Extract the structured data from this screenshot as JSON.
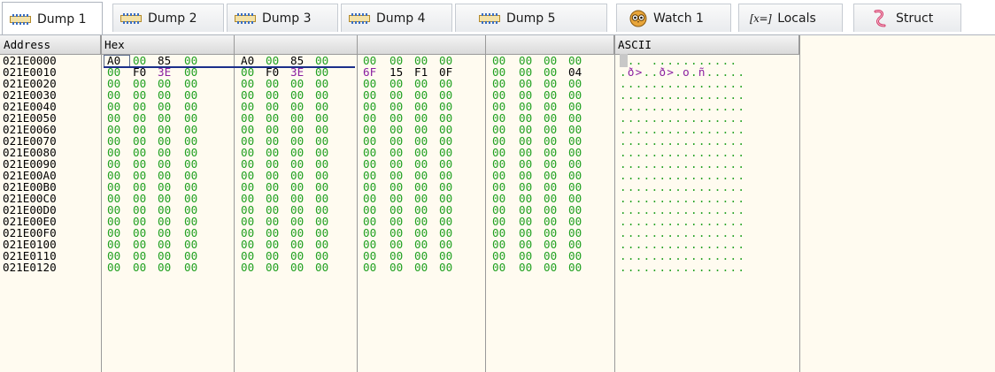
{
  "tabs": [
    {
      "label": "Dump 1",
      "icon": "memory-dump-icon",
      "active": true
    },
    {
      "label": "Dump 2",
      "icon": "memory-dump-icon",
      "active": false
    },
    {
      "label": "Dump 3",
      "icon": "memory-dump-icon",
      "active": false
    },
    {
      "label": "Dump 4",
      "icon": "memory-dump-icon",
      "active": false
    },
    {
      "label": "Dump 5",
      "icon": "memory-dump-icon",
      "active": false
    },
    {
      "label": "Watch 1",
      "icon": "watch-owl-icon",
      "active": false
    },
    {
      "label": "Locals",
      "icon": "locals-x-icon",
      "icon_text": "[x=]",
      "active": false
    },
    {
      "label": "Struct",
      "icon": "struct-icon",
      "active": false
    }
  ],
  "columns": {
    "address": "Address",
    "hex": "Hex",
    "ascii": "ASCII"
  },
  "colors": {
    "zero_byte": "#20a020",
    "nonzero_byte": "#000000",
    "ascii_printable": "#8a1fa0",
    "ascii_dot": "#20a020",
    "background": "#fffbf0",
    "selection_underline": "#1b2f8a"
  },
  "rows": [
    {
      "address": "021E0000",
      "bytes": [
        "A0",
        "00",
        "85",
        "00",
        "A0",
        "00",
        "85",
        "00",
        "00",
        "00",
        "00",
        "00",
        "00",
        "00",
        "00",
        "00"
      ],
      "ascii": "... ..........."
    },
    {
      "address": "021E0010",
      "bytes": [
        "00",
        "F0",
        "3E",
        "00",
        "00",
        "F0",
        "3E",
        "00",
        "6F",
        "15",
        "F1",
        "0F",
        "00",
        "00",
        "00",
        "04"
      ],
      "ascii": ".ð>..ð>.o.ñ....."
    },
    {
      "address": "021E0020",
      "bytes": [
        "00",
        "00",
        "00",
        "00",
        "00",
        "00",
        "00",
        "00",
        "00",
        "00",
        "00",
        "00",
        "00",
        "00",
        "00",
        "00"
      ],
      "ascii": "................"
    },
    {
      "address": "021E0030",
      "bytes": [
        "00",
        "00",
        "00",
        "00",
        "00",
        "00",
        "00",
        "00",
        "00",
        "00",
        "00",
        "00",
        "00",
        "00",
        "00",
        "00"
      ],
      "ascii": "................"
    },
    {
      "address": "021E0040",
      "bytes": [
        "00",
        "00",
        "00",
        "00",
        "00",
        "00",
        "00",
        "00",
        "00",
        "00",
        "00",
        "00",
        "00",
        "00",
        "00",
        "00"
      ],
      "ascii": "................"
    },
    {
      "address": "021E0050",
      "bytes": [
        "00",
        "00",
        "00",
        "00",
        "00",
        "00",
        "00",
        "00",
        "00",
        "00",
        "00",
        "00",
        "00",
        "00",
        "00",
        "00"
      ],
      "ascii": "................"
    },
    {
      "address": "021E0060",
      "bytes": [
        "00",
        "00",
        "00",
        "00",
        "00",
        "00",
        "00",
        "00",
        "00",
        "00",
        "00",
        "00",
        "00",
        "00",
        "00",
        "00"
      ],
      "ascii": "................"
    },
    {
      "address": "021E0070",
      "bytes": [
        "00",
        "00",
        "00",
        "00",
        "00",
        "00",
        "00",
        "00",
        "00",
        "00",
        "00",
        "00",
        "00",
        "00",
        "00",
        "00"
      ],
      "ascii": "................"
    },
    {
      "address": "021E0080",
      "bytes": [
        "00",
        "00",
        "00",
        "00",
        "00",
        "00",
        "00",
        "00",
        "00",
        "00",
        "00",
        "00",
        "00",
        "00",
        "00",
        "00"
      ],
      "ascii": "................"
    },
    {
      "address": "021E0090",
      "bytes": [
        "00",
        "00",
        "00",
        "00",
        "00",
        "00",
        "00",
        "00",
        "00",
        "00",
        "00",
        "00",
        "00",
        "00",
        "00",
        "00"
      ],
      "ascii": "................"
    },
    {
      "address": "021E00A0",
      "bytes": [
        "00",
        "00",
        "00",
        "00",
        "00",
        "00",
        "00",
        "00",
        "00",
        "00",
        "00",
        "00",
        "00",
        "00",
        "00",
        "00"
      ],
      "ascii": "................"
    },
    {
      "address": "021E00B0",
      "bytes": [
        "00",
        "00",
        "00",
        "00",
        "00",
        "00",
        "00",
        "00",
        "00",
        "00",
        "00",
        "00",
        "00",
        "00",
        "00",
        "00"
      ],
      "ascii": "................"
    },
    {
      "address": "021E00C0",
      "bytes": [
        "00",
        "00",
        "00",
        "00",
        "00",
        "00",
        "00",
        "00",
        "00",
        "00",
        "00",
        "00",
        "00",
        "00",
        "00",
        "00"
      ],
      "ascii": "................"
    },
    {
      "address": "021E00D0",
      "bytes": [
        "00",
        "00",
        "00",
        "00",
        "00",
        "00",
        "00",
        "00",
        "00",
        "00",
        "00",
        "00",
        "00",
        "00",
        "00",
        "00"
      ],
      "ascii": "................"
    },
    {
      "address": "021E00E0",
      "bytes": [
        "00",
        "00",
        "00",
        "00",
        "00",
        "00",
        "00",
        "00",
        "00",
        "00",
        "00",
        "00",
        "00",
        "00",
        "00",
        "00"
      ],
      "ascii": "................"
    },
    {
      "address": "021E00F0",
      "bytes": [
        "00",
        "00",
        "00",
        "00",
        "00",
        "00",
        "00",
        "00",
        "00",
        "00",
        "00",
        "00",
        "00",
        "00",
        "00",
        "00"
      ],
      "ascii": "................"
    },
    {
      "address": "021E0100",
      "bytes": [
        "00",
        "00",
        "00",
        "00",
        "00",
        "00",
        "00",
        "00",
        "00",
        "00",
        "00",
        "00",
        "00",
        "00",
        "00",
        "00"
      ],
      "ascii": "................"
    },
    {
      "address": "021E0110",
      "bytes": [
        "00",
        "00",
        "00",
        "00",
        "00",
        "00",
        "00",
        "00",
        "00",
        "00",
        "00",
        "00",
        "00",
        "00",
        "00",
        "00"
      ],
      "ascii": "................"
    },
    {
      "address": "021E0120",
      "bytes": [
        "00",
        "00",
        "00",
        "00",
        "00",
        "00",
        "00",
        "00",
        "00",
        "00",
        "00",
        "00",
        "00",
        "00",
        "00",
        "00"
      ],
      "ascii": "................"
    }
  ]
}
